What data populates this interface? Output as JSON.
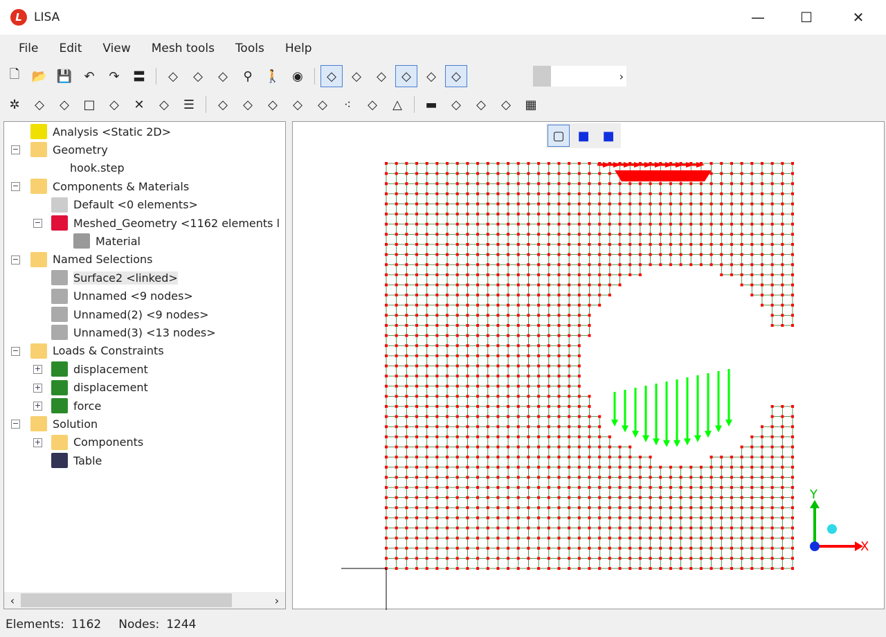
{
  "window": {
    "title": "LISA",
    "minimize": "—",
    "maximize": "☐",
    "close": "✕"
  },
  "menu": [
    "File",
    "Edit",
    "View",
    "Mesh tools",
    "Tools",
    "Help"
  ],
  "toolbar1": [
    "new-file",
    "open-folder",
    "save",
    "undo",
    "redo",
    "equals",
    "wireframe-box",
    "red-box",
    "zoom-fit",
    "zoom",
    "walk",
    "tape-measure",
    "glasses",
    "number-7",
    "colored-shape",
    "shaded-plate",
    "solid-box",
    "wire-box"
  ],
  "toolbar2": [
    "nodes",
    "node-box",
    "polyline",
    "rectangle",
    "mesh-box",
    "delete-x",
    "xyz-node",
    "list",
    "triangle-node",
    "triangle-plus",
    "extrude",
    "rotate",
    "split",
    "dots",
    "refine",
    "triangle-mesh",
    "beam",
    "shell-curved",
    "shell-bowl",
    "align",
    "film"
  ],
  "tree": [
    {
      "label": "Analysis <Static 2D>",
      "level": 0,
      "icon": "lightning",
      "color": "#f0e000"
    },
    {
      "label": "Geometry",
      "level": 0,
      "icon": "folder",
      "color": "#f8d070",
      "exp": "⊟"
    },
    {
      "label": "hook.step",
      "level": 2,
      "icon": "none",
      "color": ""
    },
    {
      "label": "Components & Materials",
      "level": 0,
      "icon": "folder-puzzle",
      "color": "#f8d070",
      "exp": "⊟"
    },
    {
      "label": "Default <0 elements>",
      "level": 1,
      "icon": "puzzle-gray",
      "color": "#ccc"
    },
    {
      "label": "Meshed_Geometry <1162 elements l",
      "level": 1,
      "icon": "puzzle-red",
      "color": "#e0103a",
      "exp": "⊟"
    },
    {
      "label": "Material",
      "level": 2,
      "icon": "plate",
      "color": "#999"
    },
    {
      "label": "Named Selections",
      "level": 0,
      "icon": "folder-cube",
      "color": "#f8d070",
      "exp": "⊟"
    },
    {
      "label": "Surface2 <linked>",
      "level": 1,
      "icon": "cube-yellow",
      "color": "#aaa",
      "selected": true
    },
    {
      "label": "Unnamed <9 nodes>",
      "level": 1,
      "icon": "cube-nodes",
      "color": "#aaa"
    },
    {
      "label": "Unnamed(2) <9 nodes>",
      "level": 1,
      "icon": "cube-nodes",
      "color": "#aaa"
    },
    {
      "label": "Unnamed(3) <13 nodes>",
      "level": 1,
      "icon": "cube-nodes",
      "color": "#aaa"
    },
    {
      "label": "Loads & Constraints",
      "level": 0,
      "icon": "folder-load",
      "color": "#f8d070",
      "exp": "⊟"
    },
    {
      "label": "displacement",
      "level": 1,
      "icon": "displacement",
      "color": "#2a8a2a",
      "exp": "⊞"
    },
    {
      "label": "displacement",
      "level": 1,
      "icon": "displacement",
      "color": "#2a8a2a",
      "exp": "⊞"
    },
    {
      "label": "force",
      "level": 1,
      "icon": "force",
      "color": "#2a8a2a",
      "exp": "⊞"
    },
    {
      "label": "Solution",
      "level": 0,
      "icon": "folder-triangle",
      "color": "#f8d070",
      "exp": "⊟"
    },
    {
      "label": "Components",
      "level": 1,
      "icon": "folder-puzzle",
      "color": "#f8d070",
      "exp": "⊞"
    },
    {
      "label": "Table",
      "level": 1,
      "icon": "table",
      "color": "#335"
    }
  ],
  "viewport": {
    "view_buttons": [
      "wireframe-cube",
      "shaded-cube",
      "solid-cube"
    ],
    "axes": {
      "x": "X",
      "y": "Y"
    },
    "colors": {
      "nodes": "#ff0000",
      "edges": "#2a7a2a",
      "force": "#ff0000",
      "displacement": "#00ff00"
    }
  },
  "status": {
    "elements_label": "Elements:",
    "elements": "1162",
    "nodes_label": "Nodes:",
    "nodes": "1244"
  }
}
